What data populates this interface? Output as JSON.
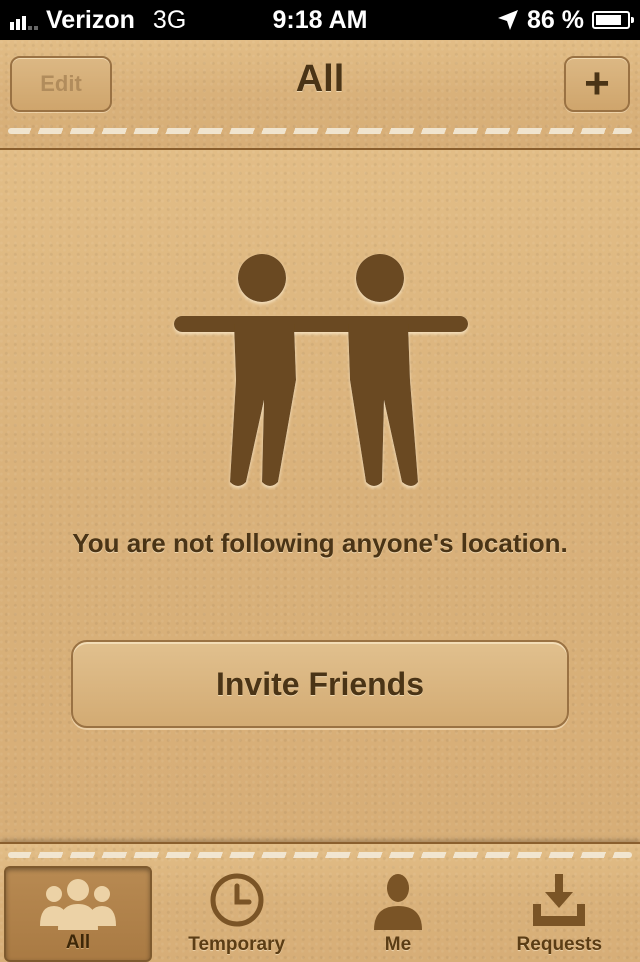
{
  "status_bar": {
    "carrier": "Verizon",
    "network": "3G",
    "time": "9:18 AM",
    "battery": "86 %",
    "battery_level": 0.86
  },
  "nav": {
    "title": "All",
    "edit_label": "Edit",
    "add_label": "+"
  },
  "main": {
    "message": "You are not following anyone's location.",
    "invite_label": "Invite Friends"
  },
  "tabs": [
    {
      "label": "All",
      "icon": "friends-group-icon",
      "active": true
    },
    {
      "label": "Temporary",
      "icon": "clock-icon",
      "active": false
    },
    {
      "label": "Me",
      "icon": "person-icon",
      "active": false
    },
    {
      "label": "Requests",
      "icon": "inbox-download-icon",
      "active": false
    }
  ],
  "colors": {
    "leather": "#d9b17a",
    "text_brown": "#4a3416",
    "icon_brown": "#6b4a20"
  }
}
